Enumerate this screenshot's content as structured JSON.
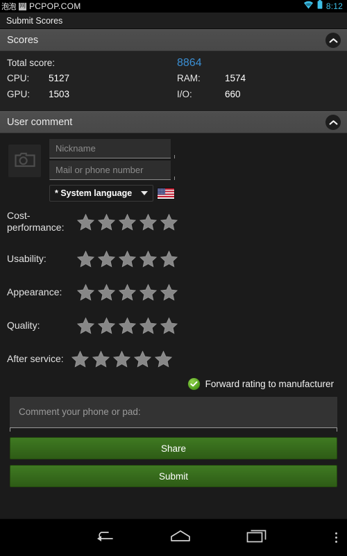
{
  "status_bar": {
    "watermark_cn": "泡泡",
    "watermark_box": "网",
    "watermark_site": "PCPOP.COM",
    "time": "8:12",
    "wifi_icon": "wifi-icon",
    "battery_icon": "battery-icon",
    "accent_color": "#3ec0e8"
  },
  "action_bar": {
    "title": "Submit Scores"
  },
  "scores_section": {
    "header": "Scores",
    "collapse_icon": "chevron-up-icon",
    "total_label": "Total score:",
    "total_value": "8864",
    "total_color": "#3b8fd4",
    "rows": [
      {
        "label_a": "CPU:",
        "value_a": "5127",
        "label_b": "RAM:",
        "value_b": "1574"
      },
      {
        "label_a": "GPU:",
        "value_a": "1503",
        "label_b": "I/O:",
        "value_b": "660"
      }
    ]
  },
  "comment_section": {
    "header": "User comment",
    "collapse_icon": "chevron-up-icon",
    "avatar_icon": "camera-icon",
    "nickname": {
      "value": "",
      "placeholder": "Nickname"
    },
    "contact": {
      "value": "",
      "placeholder": "Mail or phone number"
    },
    "language": {
      "selected": "* System language",
      "arrow_icon": "chevron-down-icon",
      "flag_icon": "us-flag-icon"
    },
    "ratings": [
      {
        "label": "Cost-performance:",
        "stars_total": 5,
        "stars_filled": 0
      },
      {
        "label": "Usability:",
        "stars_total": 5,
        "stars_filled": 0
      },
      {
        "label": "Appearance:",
        "stars_total": 5,
        "stars_filled": 0
      },
      {
        "label": "Quality:",
        "stars_total": 5,
        "stars_filled": 0
      },
      {
        "label": "After service:",
        "stars_total": 5,
        "stars_filled": 0
      }
    ],
    "forward": {
      "label": "Forward rating to manufacturer",
      "checked": true,
      "check_color": "#5aa822"
    },
    "comment": {
      "value": "",
      "placeholder": "Comment your phone or pad:"
    },
    "share_button": "Share",
    "submit_button": "Submit",
    "button_color": "#3f7a22"
  },
  "nav_bar": {
    "back_icon": "back-arrow-icon",
    "home_icon": "home-icon",
    "recents_icon": "recents-icon",
    "overflow_icon": "overflow-menu-icon"
  }
}
